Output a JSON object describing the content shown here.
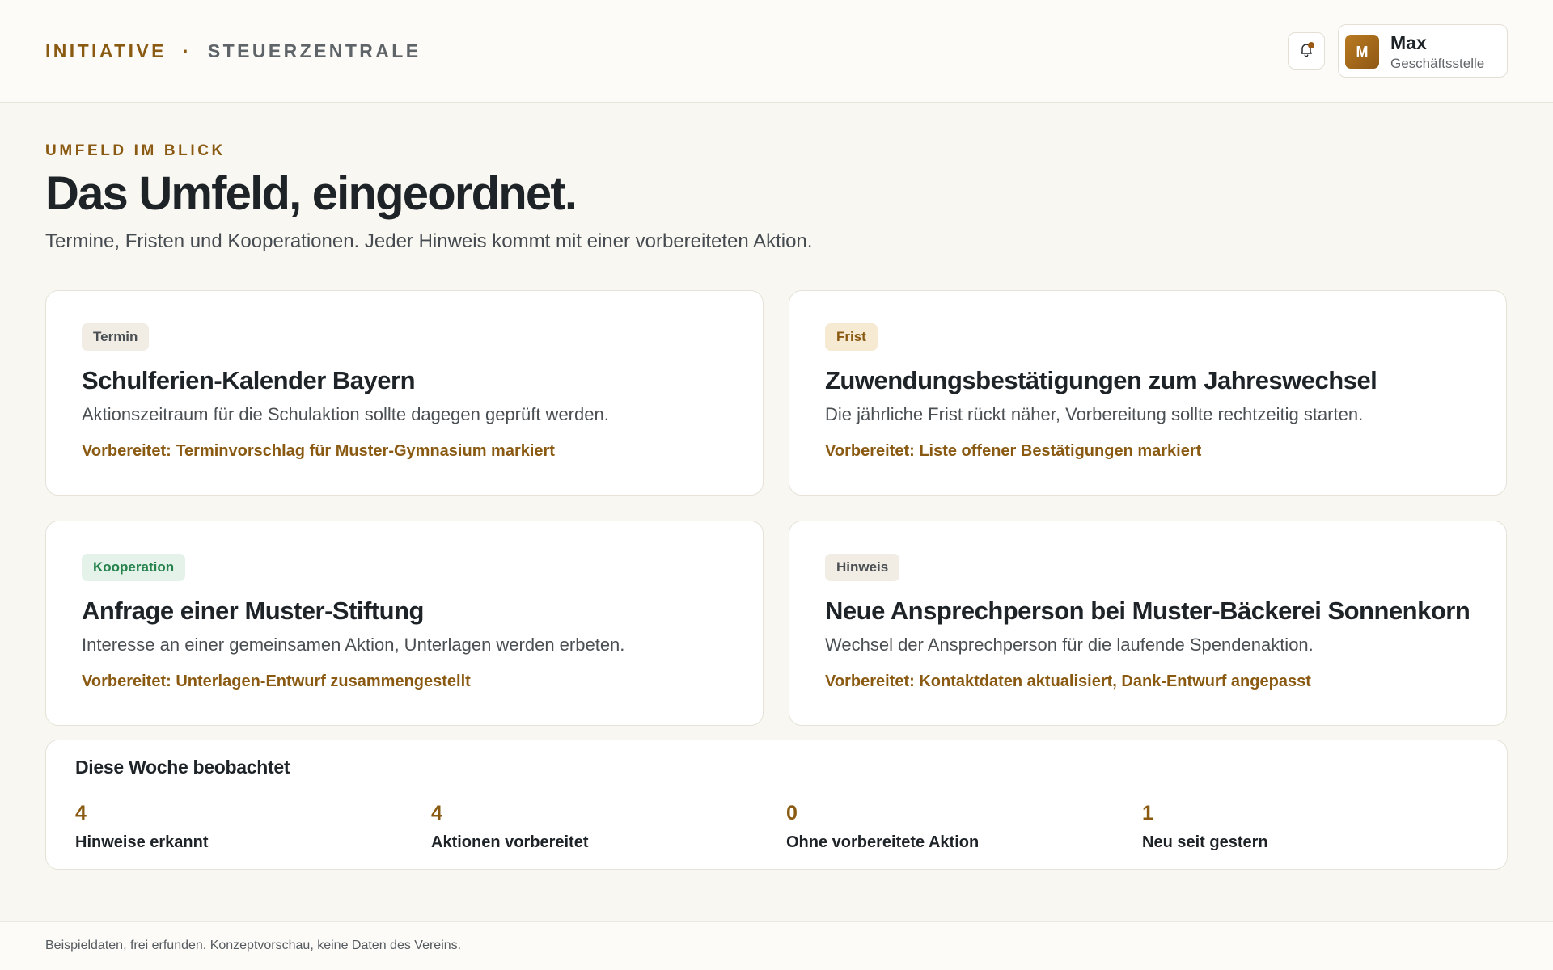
{
  "header": {
    "brand_primary": "INITIATIVE",
    "brand_separator": "·",
    "brand_secondary": "STEUERZENTRALE",
    "notification_icon": "bell-icon",
    "user": {
      "initial": "M",
      "name": "Max",
      "role": "Geschäftsstelle"
    }
  },
  "intro": {
    "eyebrow": "UMFELD IM BLICK",
    "title": "Das Umfeld, eingeordnet.",
    "subtitle": "Termine, Fristen und Kooperationen. Jeder Hinweis kommt mit einer vorbereiteten Aktion."
  },
  "cards": [
    {
      "tag": "Termin",
      "title": "Schulferien-Kalender Bayern",
      "description": "Aktionszeitraum für die Schulaktion sollte dagegen geprüft werden.",
      "prepared": "Vorbereitet: Terminvorschlag für Muster-Gymnasium markiert"
    },
    {
      "tag": "Frist",
      "title": "Zuwendungsbestätigungen zum Jahreswechsel",
      "description": "Die jährliche Frist rückt näher, Vorbereitung sollte rechtzeitig starten.",
      "prepared": "Vorbereitet: Liste offener Bestätigungen markiert"
    },
    {
      "tag": "Kooperation",
      "title": "Anfrage einer Muster-Stiftung",
      "description": "Interesse an einer gemeinsamen Aktion, Unterlagen werden erbeten.",
      "prepared": "Vorbereitet: Unterlagen-Entwurf zusammengestellt"
    },
    {
      "tag": "Hinweis",
      "title": "Neue Ansprechperson bei Muster-Bäckerei Sonnenkorn",
      "description": "Wechsel der Ansprechperson für die laufende Spendenaktion.",
      "prepared": "Vorbereitet: Kontaktdaten aktualisiert, Dank-Entwurf angepasst"
    }
  ],
  "stats": {
    "title": "Diese Woche beobachtet",
    "items": [
      {
        "value": "4",
        "label": "Hinweise erkannt"
      },
      {
        "value": "4",
        "label": "Aktionen vorbereitet"
      },
      {
        "value": "0",
        "label": "Ohne vorbereitete Aktion"
      },
      {
        "value": "1",
        "label": "Neu seit gestern"
      }
    ]
  },
  "footer": {
    "note": "Beispieldaten, frei erfunden. Konzeptvorschau, keine Daten des Vereins."
  },
  "colors": {
    "accent": "#8a5a12",
    "background": "#f9f7f2",
    "cooperation_green": "#25824c"
  }
}
